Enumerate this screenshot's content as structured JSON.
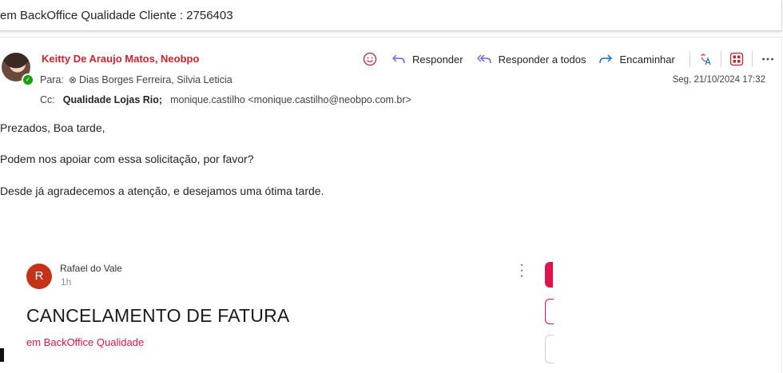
{
  "subject": "em BackOffice Qualidade Cliente : 2756403",
  "message": {
    "sender": "Keitty De Araujo Matos, Neobpo",
    "to_label": "Para:",
    "to_value": "Dias Borges Ferreira, Silvia Leticia",
    "cc_label": "Cc:",
    "cc_primary": "Qualidade Lojas Rio;",
    "cc_secondary": "monique.castilho <monique.castilho@neobpo.com.br>",
    "date": "Seg, 21/10/2024 17:32",
    "actions": {
      "reply": "Responder",
      "reply_all": "Responder a todos",
      "forward": "Encaminhar"
    },
    "body": [
      "Prezados, Boa tarde,",
      "Podem nos apoiar com essa solicitação, por favor?",
      "Desde já agradecemos a atenção, e desejamos uma ótima tarde."
    ]
  },
  "embedded_post": {
    "avatar_letter": "R",
    "author": "Rafael do Vale",
    "time": "1h",
    "title": "CANCELAMENTO DE FATURA",
    "group": "em BackOffice Qualidade"
  },
  "colors": {
    "sender": "#c4262e",
    "accent_pink": "#e0144c",
    "reply_icon": "#7160e8",
    "forward_icon": "#0f6cbd",
    "presence": "#13a10e"
  }
}
